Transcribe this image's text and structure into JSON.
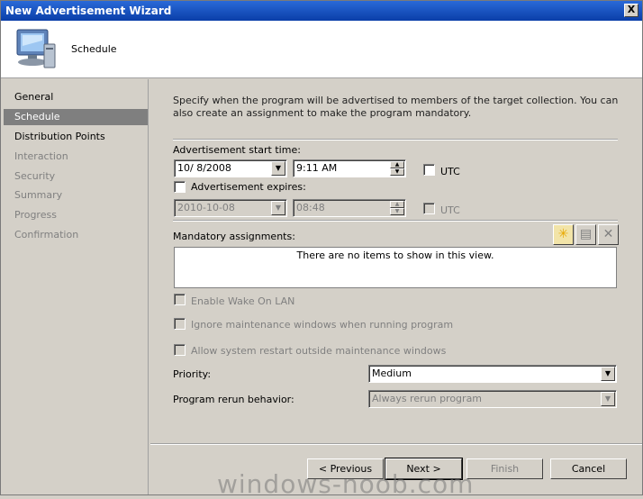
{
  "window": {
    "title": "New Advertisement Wizard",
    "close_glyph": "X"
  },
  "header": {
    "title": "Schedule",
    "icon": "computer-icon"
  },
  "sidebar": {
    "items": [
      {
        "label": "General",
        "state": "normal"
      },
      {
        "label": "Schedule",
        "state": "active"
      },
      {
        "label": "Distribution Points",
        "state": "normal"
      },
      {
        "label": "Interaction",
        "state": "disabled"
      },
      {
        "label": "Security",
        "state": "disabled"
      },
      {
        "label": "Summary",
        "state": "disabled"
      },
      {
        "label": "Progress",
        "state": "disabled"
      },
      {
        "label": "Confirmation",
        "state": "disabled"
      }
    ]
  },
  "main": {
    "description": "Specify when the program will be advertised to members of the target collection. You can also create an assignment to make the program mandatory.",
    "start_time": {
      "label": "Advertisement start time:",
      "date": "10/ 8/2008",
      "time": "9:11 AM",
      "utc_label": "UTC",
      "utc_checked": false
    },
    "expires": {
      "label": "Advertisement expires:",
      "checked": false,
      "date": "2010-10-08",
      "time": "08:48",
      "utc_label": "UTC",
      "utc_checked": false
    },
    "mandatory": {
      "label": "Mandatory assignments:",
      "empty_text": "There are no items to show in this view.",
      "toolbar": [
        "new-icon",
        "properties-icon",
        "delete-icon"
      ]
    },
    "options": [
      {
        "label": "Enable Wake On LAN",
        "checked": false
      },
      {
        "label": "Ignore maintenance windows when running program",
        "checked": false
      },
      {
        "label": "Allow system restart outside maintenance windows",
        "checked": false
      }
    ],
    "priority": {
      "label": "Priority:",
      "value": "Medium"
    },
    "rerun": {
      "label": "Program rerun behavior:",
      "value": "Always rerun program"
    }
  },
  "footer": {
    "previous": "< Previous",
    "next": "Next >",
    "finish": "Finish",
    "cancel": "Cancel"
  },
  "watermark": "windows-noob.com"
}
